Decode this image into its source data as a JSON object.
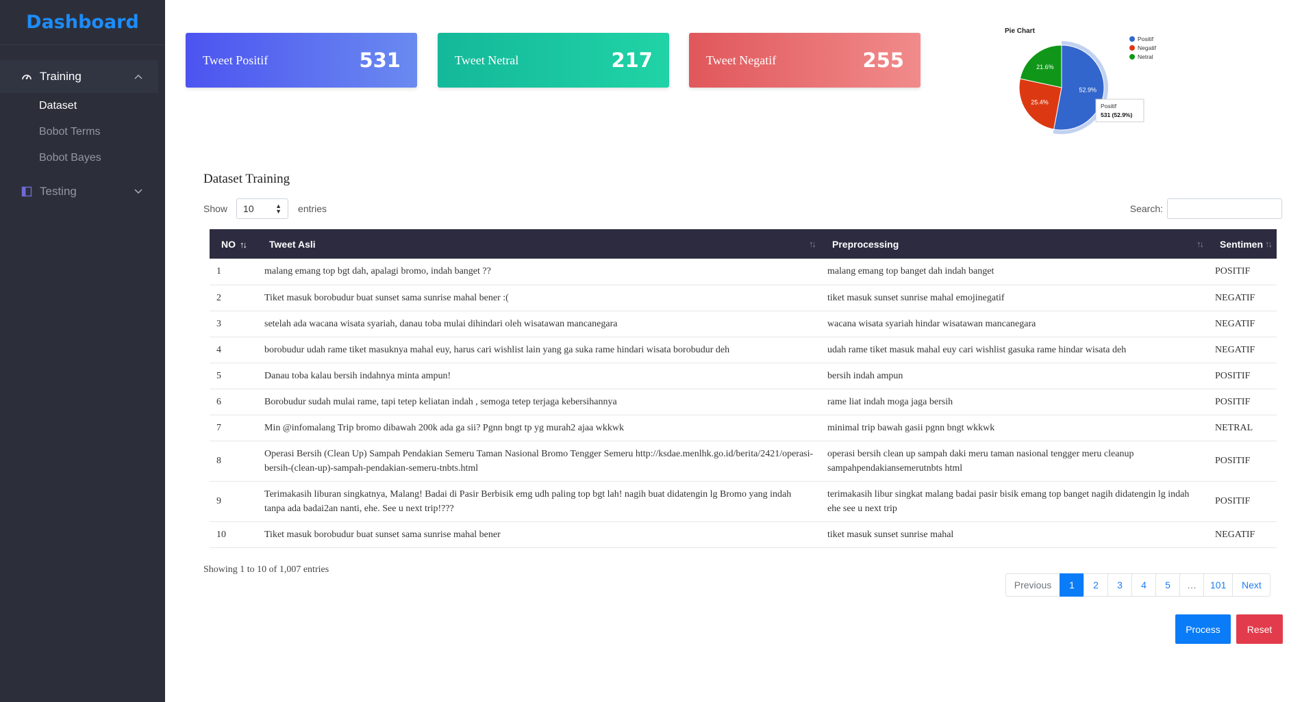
{
  "sidebar": {
    "brand": "Dashboard",
    "training": {
      "label": "Training",
      "children": [
        "Dataset",
        "Bobot Terms",
        "Bobot Bayes"
      ]
    },
    "testing": {
      "label": "Testing"
    }
  },
  "cards": [
    {
      "label": "Tweet Positif",
      "value": "531",
      "color": "#5b6cf2"
    },
    {
      "label": "Tweet Netral",
      "value": "217",
      "color": "#17c4a0"
    },
    {
      "label": "Tweet Negatif",
      "value": "255",
      "color": "#e66a6d"
    }
  ],
  "chart_data": {
    "type": "pie",
    "title": "Pie Chart",
    "slices": [
      {
        "name": "Positif",
        "value": 531,
        "percent": "52.9%",
        "color": "#3366cc"
      },
      {
        "name": "Negatif",
        "value": 255,
        "percent": "25.4%",
        "color": "#dc3912"
      },
      {
        "name": "Netral",
        "value": 217,
        "percent": "21.6%",
        "color": "#109618"
      }
    ],
    "legend": "right",
    "tooltip": {
      "name": "Positif",
      "text": "531 (52.9%)"
    }
  },
  "table": {
    "title": "Dataset Training",
    "show_label": "Show",
    "entries_value": "10",
    "entries_label": "entries",
    "search_label": "Search:",
    "columns": [
      "NO",
      "Tweet Asli",
      "Preprocessing",
      "Sentimen"
    ],
    "rows": [
      {
        "no": "1",
        "tweet": "malang emang top bgt dah, apalagi bromo, indah banget ??",
        "pre": "malang emang top banget dah indah banget",
        "sentimen": "POSITIF"
      },
      {
        "no": "2",
        "tweet": "Tiket masuk borobudur buat sunset sama sunrise mahal bener :(",
        "pre": "tiket masuk sunset sunrise mahal emojinegatif",
        "sentimen": "NEGATIF"
      },
      {
        "no": "3",
        "tweet": "setelah ada wacana wisata syariah, danau toba mulai dihindari oleh wisatawan mancanegara",
        "pre": "wacana wisata syariah hindar wisatawan mancanegara",
        "sentimen": "NEGATIF"
      },
      {
        "no": "4",
        "tweet": "borobudur udah rame tiket masuknya mahal euy, harus cari wishlist lain yang ga suka rame hindari wisata borobudur deh",
        "pre": "udah rame tiket masuk mahal euy cari wishlist gasuka rame hindar wisata deh",
        "sentimen": "NEGATIF"
      },
      {
        "no": "5",
        "tweet": "Danau toba kalau bersih indahnya minta ampun!",
        "pre": "bersih indah ampun",
        "sentimen": "POSITIF"
      },
      {
        "no": "6",
        "tweet": "Borobudur sudah mulai rame, tapi tetep keliatan indah , semoga tetep terjaga kebersihannya",
        "pre": "rame liat indah moga jaga bersih",
        "sentimen": "POSITIF"
      },
      {
        "no": "7",
        "tweet": "Min @infomalang Trip bromo dibawah 200k ada ga sii? Pgnn bngt tp yg murah2 ajaa wkkwk",
        "pre": "minimal trip bawah gasii pgnn bngt wkkwk",
        "sentimen": "NETRAL"
      },
      {
        "no": "8",
        "tweet": "Operasi Bersih (Clean Up) Sampah Pendakian Semeru Taman Nasional Bromo Tengger Semeru http://ksdae.menlhk.go.id/berita/2421/operasi-bersih-(clean-up)-sampah-pendakian-semeru-tnbts.html",
        "pre": "operasi bersih clean up sampah daki meru taman nasional tengger meru cleanup sampahpendakiansemerutnbts html",
        "sentimen": "POSITIF"
      },
      {
        "no": "9",
        "tweet": "Terimakasih liburan singkatnya, Malang! Badai di Pasir Berbisik emg udh paling top bgt lah! nagih buat didatengin lg Bromo yang indah tanpa ada badai2an nanti, ehe. See u next trip!???",
        "pre": "terimakasih libur singkat malang badai pasir bisik emang top banget nagih didatengin lg indah ehe see u next trip",
        "sentimen": "POSITIF"
      },
      {
        "no": "10",
        "tweet": "Tiket masuk borobudur buat sunset sama sunrise mahal bener",
        "pre": "tiket masuk sunset sunrise mahal",
        "sentimen": "NEGATIF"
      }
    ],
    "info": "Showing 1 to 10 of 1,007 entries"
  },
  "pagination": {
    "previous": "Previous",
    "pages": [
      "1",
      "2",
      "3",
      "4",
      "5",
      "…",
      "101"
    ],
    "next": "Next"
  },
  "actions": {
    "process": "Process",
    "reset": "Reset"
  }
}
